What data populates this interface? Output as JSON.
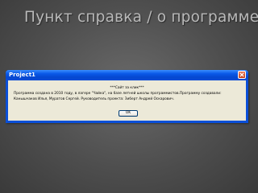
{
  "slide": {
    "title": "Пункт справка / о программе"
  },
  "dialog": {
    "title": "Project1",
    "close_icon": "close-icon",
    "caption": "***Сайт за клик***",
    "body": "Программа создана в 2010 году, в лагере \"Чайка\", на базе летней школы программистов.Программу создавали: Канышчаков Илья, Муратов Сергей. Руководитель проекта: Зиберт Андрей Оскарович.",
    "ok_label": "OK"
  },
  "colors": {
    "titlebar": "#0a5ae8",
    "dialog_face": "#ece9d8",
    "close_button": "#c43a12",
    "slide_background": "#555555",
    "slide_title": "#b9b9b9"
  }
}
